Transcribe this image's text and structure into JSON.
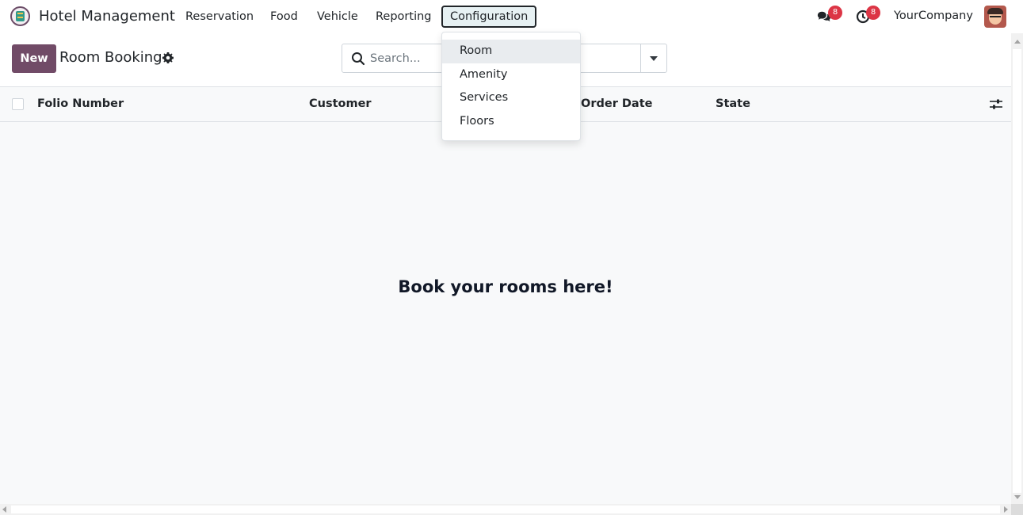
{
  "navbar": {
    "app_title": "Hotel Management",
    "menu": [
      {
        "label": "Reservation"
      },
      {
        "label": "Food"
      },
      {
        "label": "Vehicle"
      },
      {
        "label": "Reporting"
      },
      {
        "label": "Configuration",
        "active": true
      }
    ],
    "messages_badge": "8",
    "activities_badge": "8",
    "company": "YourCompany",
    "icons": [
      "app-logo-icon",
      "chat-icon",
      "clock-icon",
      "user-avatar"
    ]
  },
  "control_panel": {
    "new_button": "New",
    "breadcrumb": "Room Booking",
    "search_placeholder": "Search..."
  },
  "list": {
    "columns": [
      "Folio Number",
      "Customer",
      "Order Date",
      "State"
    ]
  },
  "helper": {
    "text": "Book your rooms here!"
  },
  "dropdown": {
    "items": [
      {
        "label": "Room",
        "highlighted": true
      },
      {
        "label": "Amenity"
      },
      {
        "label": "Services"
      },
      {
        "label": "Floors"
      }
    ]
  },
  "colors": {
    "brand": "#714b67",
    "badge": "#dc3545",
    "active_menu_bg": "#e7f1f3"
  }
}
